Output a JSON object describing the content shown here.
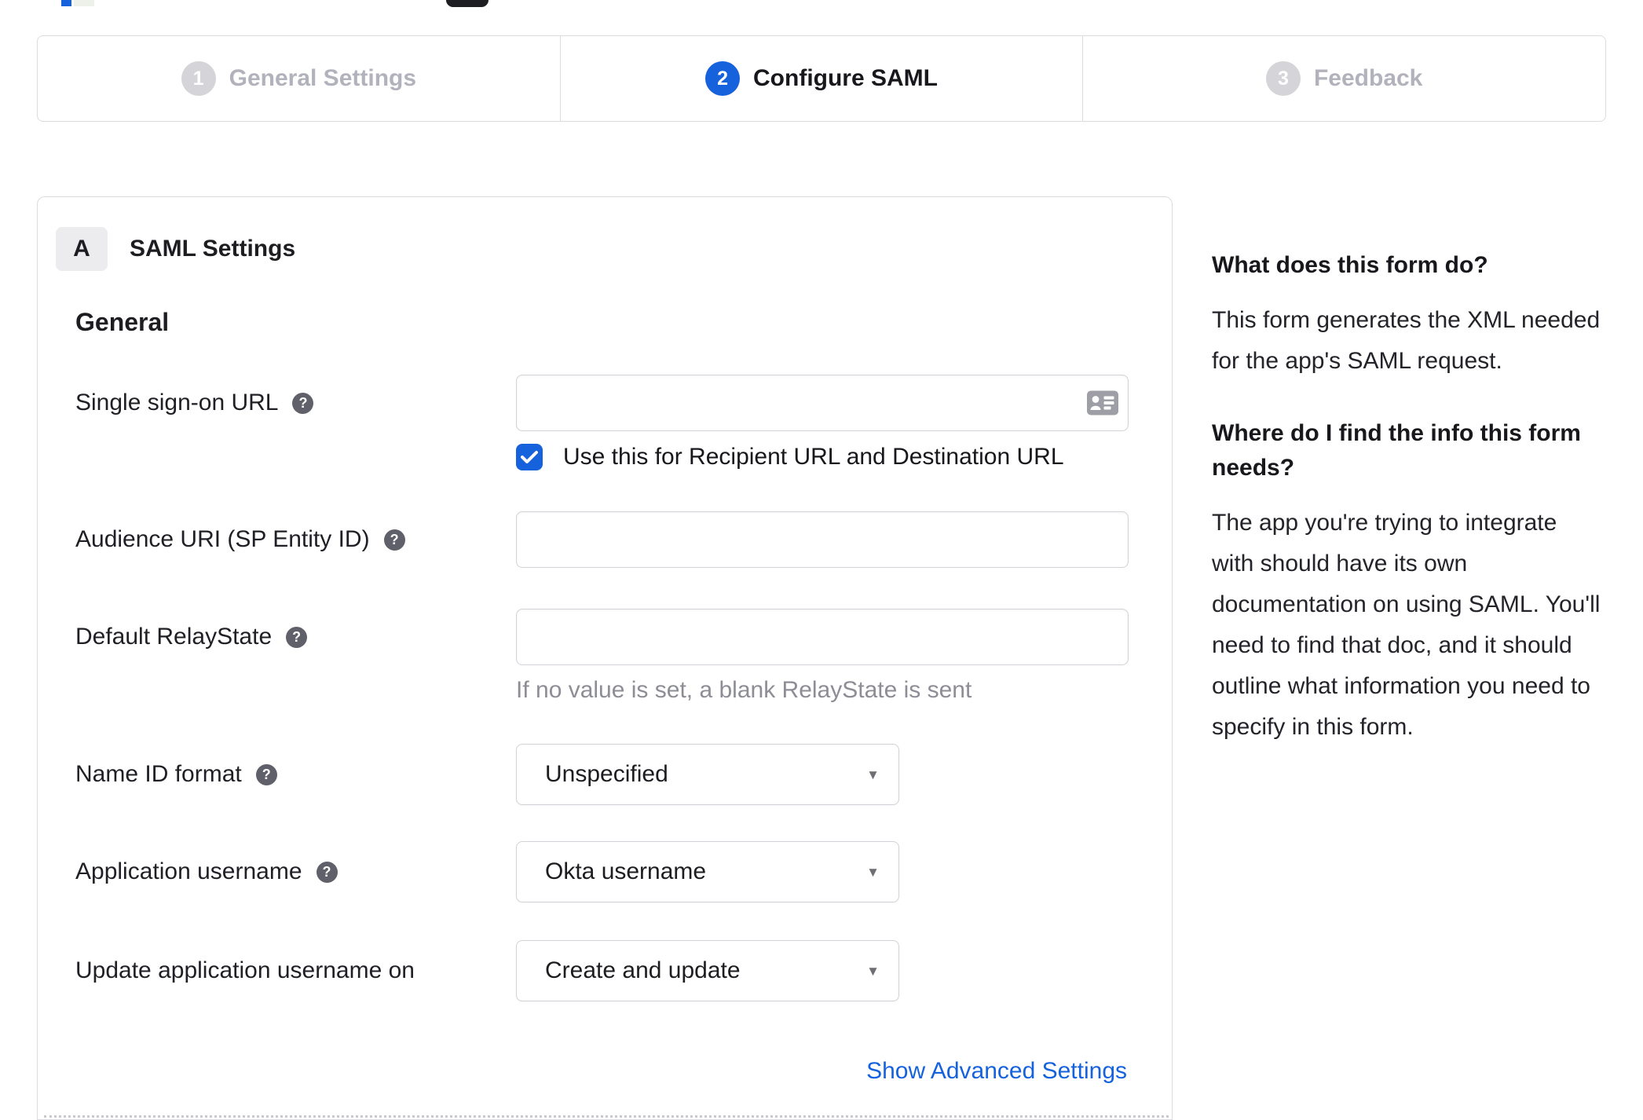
{
  "colors": {
    "accent": "#1662dd",
    "inactive_step": "#d4d4d9",
    "border": "#dcdce0",
    "hint_text": "#8d8d95"
  },
  "icons": {
    "help_glyph": "?",
    "dropdown_caret": "▼",
    "sso_input_icon": "contact-card-icon"
  },
  "stepper": {
    "steps": [
      {
        "number": "1",
        "label": "General Settings",
        "state": "inactive"
      },
      {
        "number": "2",
        "label": "Configure SAML",
        "state": "active"
      },
      {
        "number": "3",
        "label": "Feedback",
        "state": "inactive"
      }
    ]
  },
  "panel": {
    "badge": "A",
    "title": "SAML Settings",
    "section_heading": "General",
    "fields": {
      "sso_url": {
        "label": "Single sign-on URL",
        "value": "",
        "placeholder": "",
        "checkbox_label": "Use this for Recipient URL and Destination URL",
        "checkbox_checked": true
      },
      "audience_uri": {
        "label": "Audience URI (SP Entity ID)",
        "value": "",
        "placeholder": ""
      },
      "relay_state": {
        "label": "Default RelayState",
        "value": "",
        "placeholder": "",
        "hint": "If no value is set, a blank RelayState is sent"
      },
      "name_id_format": {
        "label": "Name ID format",
        "selected": "Unspecified"
      },
      "app_username": {
        "label": "Application username",
        "selected": "Okta username"
      },
      "update_app_username": {
        "label": "Update application username on",
        "selected": "Create and update"
      }
    },
    "advanced_link": "Show Advanced Settings"
  },
  "help": {
    "q1": "What does this form do?",
    "a1": "This form generates the XML needed for the app's SAML request.",
    "q2": "Where do I find the info this form needs?",
    "a2": "The app you're trying to integrate with should have its own documentation on using SAML. You'll need to find that doc, and it should outline what information you need to specify in this form."
  }
}
